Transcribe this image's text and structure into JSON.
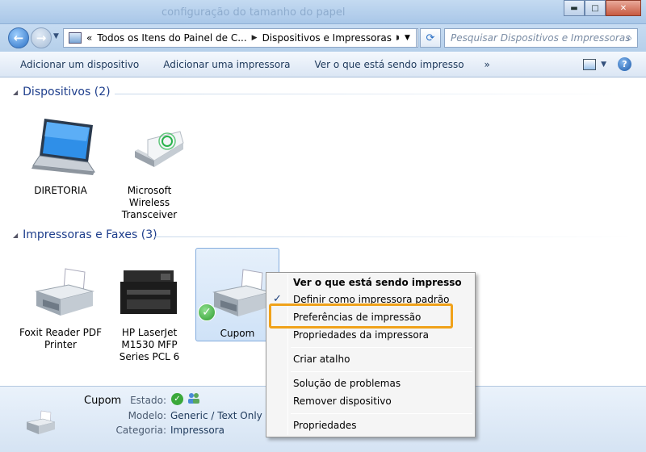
{
  "window": {
    "ghost_title": "configuração do tamanho do papel",
    "min_glyph": "▬",
    "max_glyph": "□",
    "close_glyph": "✕"
  },
  "nav": {
    "back_glyph": "←",
    "forward_glyph": "→",
    "dropdown_glyph": "▼",
    "refresh_glyph": "⟳",
    "breadcrumb": [
      {
        "label": "Todos os Itens do Painel de C..."
      },
      {
        "label": "Dispositivos e Impressoras"
      }
    ],
    "breadcrumb_sep": "▶",
    "root_sep": "«",
    "search_placeholder": "Pesquisar Dispositivos e Impressoras",
    "search_glyph": "⌕"
  },
  "toolbar": {
    "buttons": [
      {
        "label": "Adicionar um dispositivo"
      },
      {
        "label": "Adicionar uma impressora"
      },
      {
        "label": "Ver o que está sendo impresso"
      }
    ],
    "more_glyph": "»",
    "view_dropdown_glyph": "▼",
    "help_glyph": "?"
  },
  "groups": {
    "devices": {
      "title": "Dispositivos (2)",
      "items": [
        {
          "label": "DIRETORIA",
          "icon": "laptop-icon"
        },
        {
          "label": "Microsoft Wireless Transceiver",
          "icon": "usb-transceiver-icon"
        }
      ]
    },
    "printers": {
      "title": "Impressoras e Faxes (3)",
      "items": [
        {
          "label": "Foxit Reader PDF Printer",
          "icon": "printer-icon"
        },
        {
          "label": "HP LaserJet M1530 MFP Series PCL 6",
          "icon": "mfp-printer-icon"
        },
        {
          "label": "Cupom",
          "icon": "printer-icon",
          "default": true
        }
      ]
    }
  },
  "details": {
    "name": "Cupom",
    "status_label": "Estado:",
    "model_label": "Modelo:",
    "model_value": "Generic / Text Only",
    "category_label": "Categoria:",
    "category_value": "Impressora"
  },
  "context_menu": {
    "items": [
      {
        "label": "Ver o que está sendo impresso",
        "bold": true
      },
      {
        "label": "Definir como impressora padrão",
        "checked": true
      },
      {
        "label": "Preferências de impressão",
        "highlighted": true
      },
      {
        "label": "Propriedades da impressora"
      },
      {
        "label": "Criar atalho"
      },
      {
        "label": "Solução de problemas"
      },
      {
        "label": "Remover dispositivo"
      },
      {
        "label": "Propriedades"
      }
    ],
    "check_glyph": "✓"
  },
  "colors": {
    "group_header": "#1e3e8c",
    "highlight_outline": "#f0a21a",
    "default_check": "#2e9b2e"
  }
}
